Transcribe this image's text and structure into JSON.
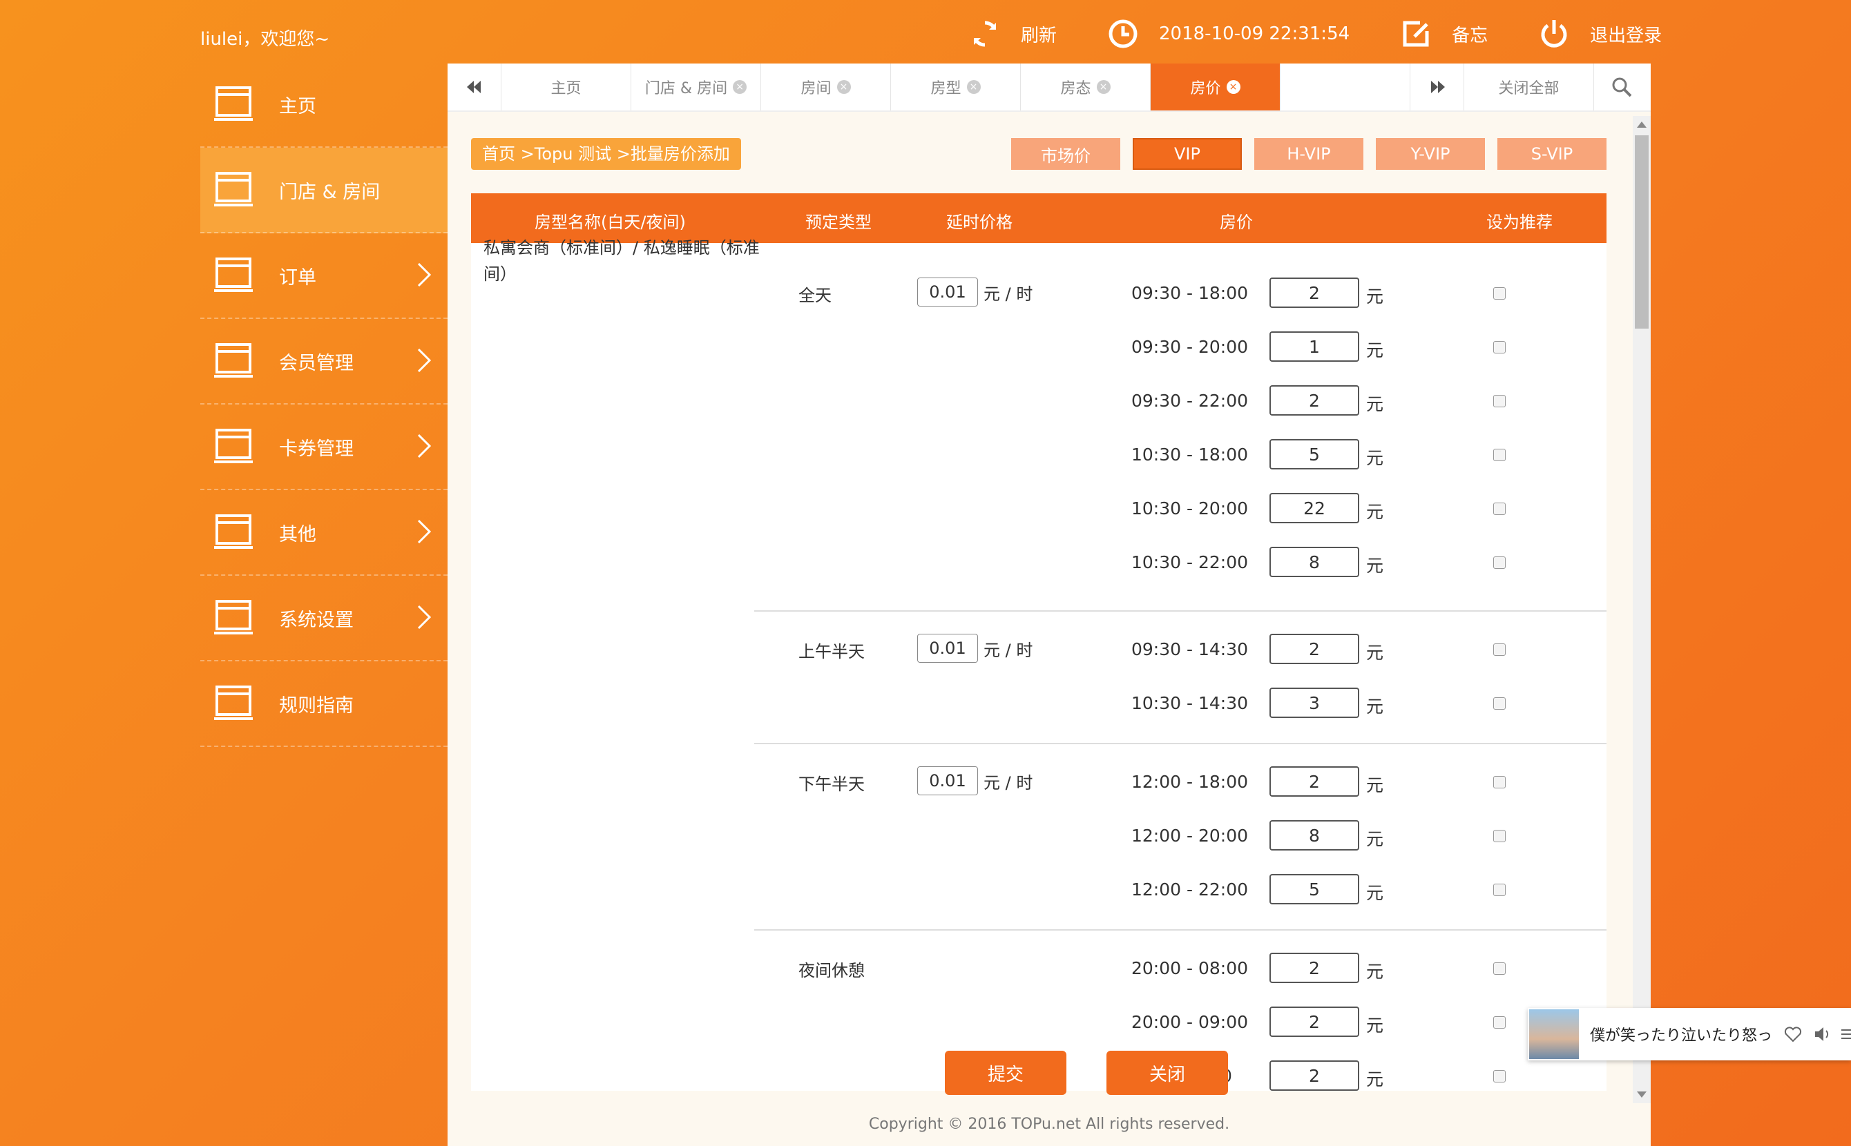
{
  "header": {
    "welcome": "liulei，欢迎您~",
    "refresh": "刷新",
    "datetime": "2018-10-09 22:31:54",
    "memo": "备忘",
    "logout": "退出登录"
  },
  "sidebar": {
    "items": [
      {
        "label": "主页",
        "has_arrow": false,
        "active": false
      },
      {
        "label": "门店 & 房间",
        "has_arrow": false,
        "active": true
      },
      {
        "label": "订单",
        "has_arrow": true,
        "active": false
      },
      {
        "label": "会员管理",
        "has_arrow": true,
        "active": false
      },
      {
        "label": "卡券管理",
        "has_arrow": true,
        "active": false
      },
      {
        "label": "其他",
        "has_arrow": true,
        "active": false
      },
      {
        "label": "系统设置",
        "has_arrow": true,
        "active": false
      },
      {
        "label": "规则指南",
        "has_arrow": false,
        "active": false
      }
    ]
  },
  "tabs": {
    "items": [
      "主页",
      "门店 & 房间",
      "房间",
      "房型",
      "房态",
      "房价"
    ],
    "active": "房价",
    "close_all": "关闭全部"
  },
  "breadcrumb": "首页 >Topu 测试 >批量房价添加",
  "price_tabs": {
    "items": [
      "市场价",
      "VIP",
      "H-VIP",
      "Y-VIP",
      "S-VIP"
    ],
    "active": "VIP"
  },
  "table": {
    "headers": {
      "room": "房型名称(白天/夜间)",
      "type": "预定类型",
      "delay": "延时价格",
      "price": "房价",
      "recommend": "设为推荐"
    },
    "room_name": "私寓会商（标准间）/ 私逸睡眠（标准间）",
    "unit": "元",
    "delay_unit": "元 / 时",
    "groups": [
      {
        "type": "全天",
        "delay": "0.01",
        "rows": [
          {
            "time": "09:30 - 18:00",
            "price": "2"
          },
          {
            "time": "09:30 - 20:00",
            "price": "1"
          },
          {
            "time": "09:30 - 22:00",
            "price": "2"
          },
          {
            "time": "10:30 - 18:00",
            "price": "5"
          },
          {
            "time": "10:30 - 20:00",
            "price": "22"
          },
          {
            "time": "10:30 - 22:00",
            "price": "8"
          }
        ]
      },
      {
        "type": "上午半天",
        "delay": "0.01",
        "rows": [
          {
            "time": "09:30 - 14:30",
            "price": "2"
          },
          {
            "time": "10:30 - 14:30",
            "price": "3"
          }
        ]
      },
      {
        "type": "下午半天",
        "delay": "0.01",
        "rows": [
          {
            "time": "12:00 - 18:00",
            "price": "2"
          },
          {
            "time": "12:00 - 20:00",
            "price": "8"
          },
          {
            "time": "12:00 - 22:00",
            "price": "5"
          }
        ]
      },
      {
        "type": "夜间休憩",
        "delay": null,
        "rows": [
          {
            "time": "20:00 - 08:00",
            "price": "2"
          },
          {
            "time": "20:00 - 09:00",
            "price": "2"
          },
          {
            "time": "0",
            "price": "2"
          }
        ]
      }
    ]
  },
  "buttons": {
    "submit": "提交",
    "close": "关闭"
  },
  "footer": "Copyright © 2016 TOPu.net All rights reserved.",
  "music": {
    "title": "僕が笑ったり泣いたり怒っ"
  },
  "colors": {
    "accent": "#f26b1d",
    "light_accent": "#f9a43a",
    "background": "#fdf8ef"
  }
}
